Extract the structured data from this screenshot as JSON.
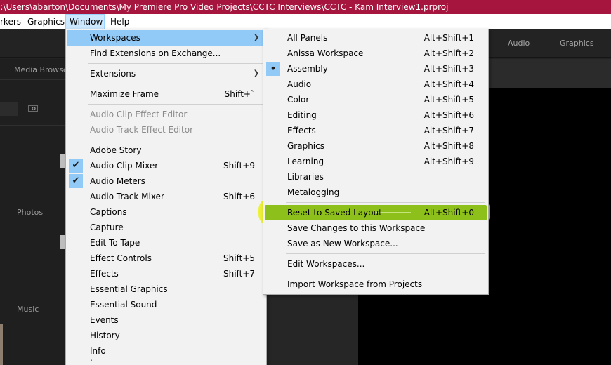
{
  "title_bar": {
    "text": "C:\\Users\\abarton\\Documents\\My Premiere Pro Video Projects\\CCTC Interviews\\CCTC - Kam Interview1.prproj"
  },
  "menu_bar": {
    "markers": "rkers",
    "graphics": "Graphics",
    "window": "Window",
    "help": "Help"
  },
  "workspace_tabs": {
    "audio": "Audio",
    "graphics": "Graphics"
  },
  "left_panel": {
    "media_browser": "Media Browse",
    "photos": "Photos",
    "music": "Music"
  },
  "window_menu": {
    "items": [
      {
        "label": "Workspaces",
        "shortcut": "",
        "submenu": true
      },
      {
        "label": "Find Extensions on Exchange...",
        "shortcut": ""
      },
      {
        "label": "Extensions",
        "shortcut": "",
        "submenu": true
      },
      {
        "label": "Maximize Frame",
        "shortcut": "Shift+`"
      },
      {
        "label": "Audio Clip Effect Editor",
        "shortcut": "",
        "disabled": true
      },
      {
        "label": "Audio Track Effect Editor",
        "shortcut": "",
        "disabled": true
      },
      {
        "label": "Adobe Story",
        "shortcut": ""
      },
      {
        "label": "Audio Clip Mixer",
        "shortcut": "Shift+9",
        "checked": true
      },
      {
        "label": "Audio Meters",
        "shortcut": "",
        "checked": true
      },
      {
        "label": "Audio Track Mixer",
        "shortcut": "Shift+6"
      },
      {
        "label": "Captions",
        "shortcut": ""
      },
      {
        "label": "Capture",
        "shortcut": ""
      },
      {
        "label": "Edit To Tape",
        "shortcut": ""
      },
      {
        "label": "Effect Controls",
        "shortcut": "Shift+5"
      },
      {
        "label": "Effects",
        "shortcut": "Shift+7"
      },
      {
        "label": "Essential Graphics",
        "shortcut": ""
      },
      {
        "label": "Essential Sound",
        "shortcut": ""
      },
      {
        "label": "Events",
        "shortcut": ""
      },
      {
        "label": "History",
        "shortcut": ""
      },
      {
        "label": "Info",
        "shortcut": ""
      }
    ]
  },
  "workspaces_menu": {
    "items": [
      {
        "label": "All Panels",
        "shortcut": "Alt+Shift+1"
      },
      {
        "label": "Anissa Workspace",
        "shortcut": "Alt+Shift+2"
      },
      {
        "label": "Assembly",
        "shortcut": "Alt+Shift+3",
        "selected": true
      },
      {
        "label": "Audio",
        "shortcut": "Alt+Shift+4"
      },
      {
        "label": "Color",
        "shortcut": "Alt+Shift+5"
      },
      {
        "label": "Editing",
        "shortcut": "Alt+Shift+6"
      },
      {
        "label": "Effects",
        "shortcut": "Alt+Shift+7"
      },
      {
        "label": "Graphics",
        "shortcut": "Alt+Shift+8"
      },
      {
        "label": "Learning",
        "shortcut": "Alt+Shift+9"
      },
      {
        "label": "Libraries",
        "shortcut": ""
      },
      {
        "label": "Metalogging",
        "shortcut": ""
      },
      {
        "label": "Reset to Saved Layout",
        "shortcut": "Alt+Shift+0",
        "highlighted": true
      },
      {
        "label": "Save Changes to this Workspace",
        "shortcut": ""
      },
      {
        "label": "Save as New Workspace...",
        "shortcut": ""
      },
      {
        "label": "Edit Workspaces...",
        "shortcut": ""
      },
      {
        "label": "Import Workspace from Projects",
        "shortcut": ""
      }
    ]
  },
  "colors": {
    "title_bar": "#a5153e",
    "menu_highlight": "#91c9f7",
    "annotation_highlight": "#ebf01e",
    "reset_highlight": "#8ec01c"
  }
}
